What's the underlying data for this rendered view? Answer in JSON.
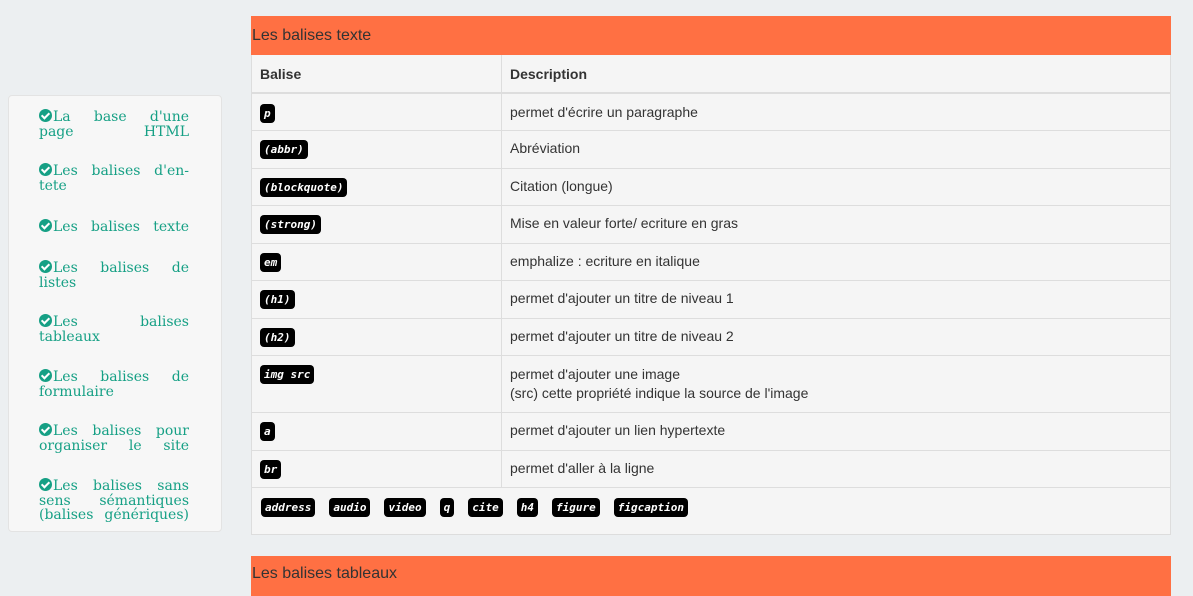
{
  "sidebar": {
    "items": [
      {
        "label": "La base d'une page HTML"
      },
      {
        "label": "Les balises d'en-tete"
      },
      {
        "label": "Les balises texte"
      },
      {
        "label": "Les balises de listes"
      },
      {
        "label": "Les balises tableaux"
      },
      {
        "label": "Les balises de formulaire"
      },
      {
        "label": "Les balises pour organiser le site"
      },
      {
        "label": "Les balises sans sens sémantiques (balises génériques)"
      }
    ]
  },
  "panel": {
    "title": "Les balises texte",
    "col_balise": "Balise",
    "col_description": "Description",
    "rows": [
      {
        "tag": "p",
        "desc": "permet d'écrire un paragraphe"
      },
      {
        "tag": "(abbr)",
        "desc": "Abréviation"
      },
      {
        "tag": "(blockquote)",
        "desc": "Citation (longue)"
      },
      {
        "tag": "(strong)",
        "desc": "Mise en valeur forte/ ecriture en gras"
      },
      {
        "tag": "em",
        "desc": "emphalize : ecriture en italique"
      },
      {
        "tag": "(h1)",
        "desc": "permet d'ajouter un titre de niveau 1"
      },
      {
        "tag": "(h2)",
        "desc": "permet d'ajouter un titre de niveau 2"
      },
      {
        "tag": "img src",
        "desc": "permet d'ajouter une image",
        "desc2": "(src) cette propriété indique la source de l'image"
      },
      {
        "tag": "a",
        "desc": "permet d'ajouter un lien hypertexte"
      },
      {
        "tag": "br",
        "desc": "permet d'aller à la ligne"
      }
    ],
    "extra_tags": [
      "address",
      "audio",
      "video",
      "q",
      "cite",
      "h4",
      "figure",
      "figcaption"
    ]
  },
  "panel2": {
    "title": "Les balises tableaux"
  },
  "colors": {
    "accent": "#ff7043",
    "link": "#16a085"
  }
}
